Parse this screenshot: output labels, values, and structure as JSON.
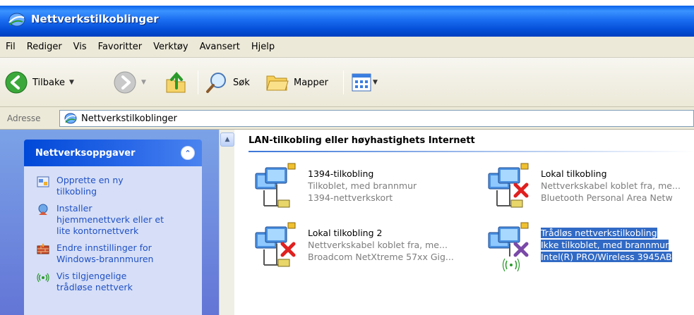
{
  "window": {
    "title": "Nettverkstilkoblinger"
  },
  "menu": [
    "Fil",
    "Rediger",
    "Vis",
    "Favoritter",
    "Verktøy",
    "Avansert",
    "Hjelp"
  ],
  "toolbar": {
    "back_label": "Tilbake",
    "search_label": "Søk",
    "folders_label": "Mapper"
  },
  "address": {
    "label": "Adresse",
    "value": "Nettverkstilkoblinger"
  },
  "taskpane": {
    "header": "Nettverksoppgaver",
    "tasks": [
      {
        "label": "Opprette en ny tilkobling",
        "lines": [
          "Opprette en ny",
          "tilkobling"
        ]
      },
      {
        "label": "Installer hjemmenettverk eller et lite kontornettverk",
        "lines": [
          "Installer",
          "hjemmenettverk eller et",
          "lite kontornettverk"
        ]
      },
      {
        "label": "Endre innstillinger for Windows-brannmuren",
        "lines": [
          "Endre innstillinger for",
          "Windows-brannmuren"
        ]
      },
      {
        "label": "Vis tilgjengelige trådløse nettverk",
        "lines": [
          "Vis tilgjengelige",
          "trådløse nettverk"
        ]
      }
    ]
  },
  "main": {
    "group_title": "LAN-tilkobling eller høyhastighets Internett",
    "connections": [
      {
        "name": "1394-tilkobling",
        "status": "Tilkoblet, med brannmur",
        "device": "1394-nettverkskort",
        "state": "connected"
      },
      {
        "name": "Lokal tilkobling",
        "status": "Nettverkskabel koblet fra, me...",
        "device": "Bluetooth Personal Area Netw",
        "state": "disconnected"
      },
      {
        "name": "Lokal tilkobling 2",
        "status": "Nettverkskabel koblet fra, me...",
        "device": "Broadcom NetXtreme 57xx Gig...",
        "state": "disconnected"
      },
      {
        "name": "Trådløs nettverkstilkobling",
        "status": "Ikke tilkoblet, med brannmur",
        "device": "Intel(R) PRO/Wireless 3945AB",
        "state": "wireless-not-connected",
        "selected": true
      }
    ]
  },
  "colors": {
    "accent": "#316ac5",
    "titlebar": "#0058e6",
    "link": "#2150c4"
  }
}
